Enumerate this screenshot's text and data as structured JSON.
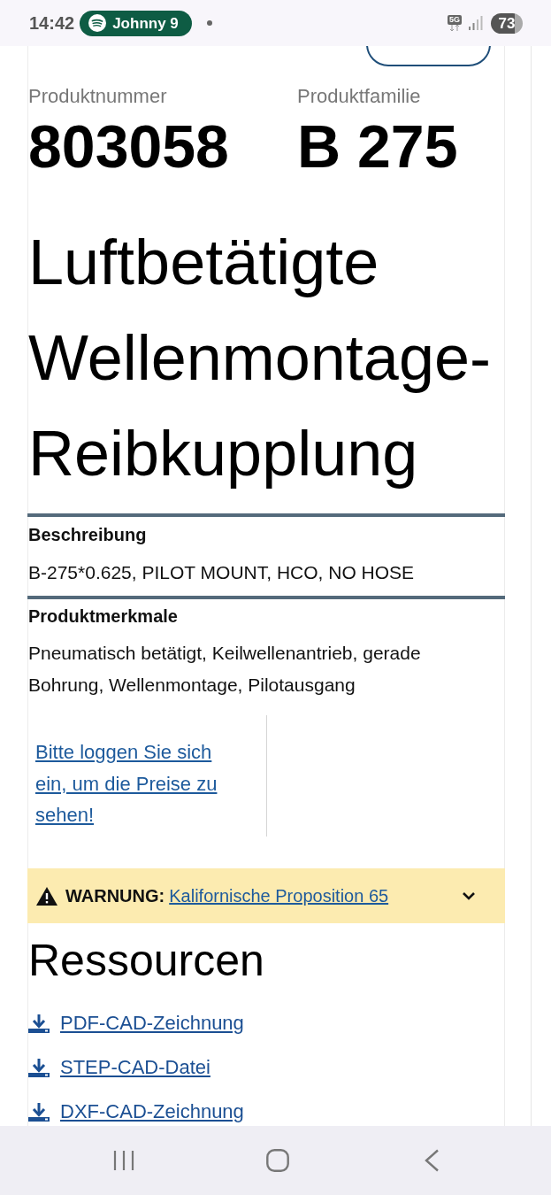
{
  "status_bar": {
    "time": "14:42",
    "media_pill": "Johnny 9",
    "network": "5G",
    "battery": "73"
  },
  "product": {
    "fields": [
      {
        "label": "Produktnummer",
        "value": "803058"
      },
      {
        "label": "Produktfamilie",
        "value": "B 275"
      }
    ],
    "title": "Luftbetätigte Wellenmontage-Reibkupplung"
  },
  "sections": [
    {
      "heading": "Beschreibung",
      "text": "B-275*0.625, PILOT MOUNT, HCO, NO HOSE"
    },
    {
      "heading": "Produktmerkmale",
      "text": "Pneumatisch betätigt, Keilwellenantrieb, gerade Bohrung, Wellenmontage, Pilotausgang"
    }
  ],
  "login_link": "Bitte loggen Sie sich ein, um die Preise zu sehen!",
  "warning": {
    "label": "WARNUNG:",
    "link": "Kalifornische Proposition 65",
    "expanded": false
  },
  "resources": {
    "heading": "Ressourcen",
    "links": [
      "PDF-CAD-Zeichnung",
      "STEP-CAD-Datei",
      "DXF-CAD-Zeichnung"
    ]
  }
}
